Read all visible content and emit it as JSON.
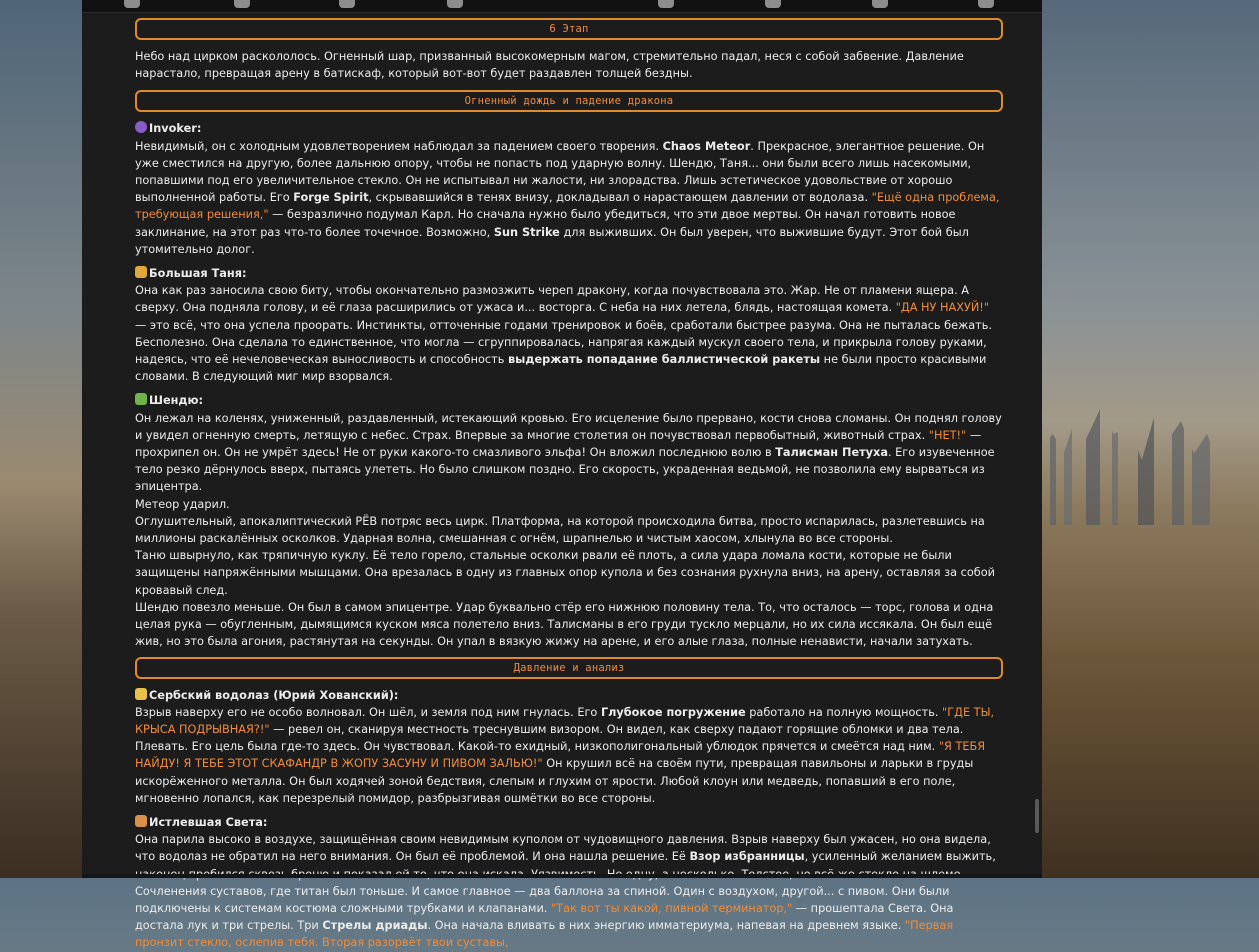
{
  "colors": {
    "accent": "#f08d3a",
    "panel_bg": "#1c1c1c",
    "text": "#ececec"
  },
  "toolbar_icons": [
    "settings-icon",
    "pin-icon",
    "font-icon",
    "script-icon",
    "image-icon",
    "extensions-icon",
    "emoji-icon",
    "user-icon"
  ],
  "stage_header": "6 Этап",
  "intro": "Небо над цирком раскололось. Огненный шар, призванный высокомерным магом, стремительно падал, неся с собой забвение. Давление нарастало, превращая арену в батискаф, который вот-вот будет раздавлен толщей бездны.",
  "section1": {
    "title": "Огненный дождь и падение дракона",
    "invoker": {
      "name": "Invoker:",
      "t1": "Невидимый, он с холодным удовлетворением наблюдал за падением своего творения. ",
      "b1": "Chaos Meteor",
      "t2": ". Прекрасное, элегантное решение. Он уже сместился на другую, более дальнюю опору, чтобы не попасть под ударную волну. Шендю, Таня... они были всего лишь насекомыми, попавшими под его увеличительное стекло. Он не испытывал ни жалости, ни злорадства. Лишь эстетическое удовольствие от хорошо выполненной работы. Его ",
      "b2": "Forge Spirit",
      "t3": ", скрывавшийся в тенях внизу, докладывал о нарастающем давлении от водолаза. ",
      "q1": "\"Ещё одна проблема, требующая решения,\"",
      "t4": " — безразлично подумал Карл. Но сначала нужно было убедиться, что эти двое мертвы. Он начал готовить новое заклинание, на этот раз что-то более точечное. Возможно, ",
      "b3": "Sun Strike",
      "t5": " для выживших. Он был уверен, что выжившие будут. Этот бой был утомительно долог."
    },
    "tanya": {
      "name": "Большая Таня:",
      "t1": "Она как раз заносила свою биту, чтобы окончательно размозжить череп дракону, когда почувствовала это. Жар. Не от пламени ящера. А сверху. Она подняла голову, и её глаза расширились от ужаса и... восторга. С неба на них летела, блядь, настоящая комета. ",
      "q1": "\"ДА НУ НАХУЙ!\"",
      "t2": " — это всё, что она успела проорать. Инстинкты, отточенные годами тренировок и боёв, сработали быстрее разума. Она не пыталась бежать. Бесполезно. Она сделала то единственное, что могла — сгруппировалась, напрягая каждый мускул своего тела, и прикрыла голову руками, надеясь, что её нечеловеческая выносливость и способность ",
      "b1": "выдержать попадание баллистической ракеты",
      "t3": " не были просто красивыми словами. В следующий миг мир взорвался."
    },
    "shendu": {
      "name": "Шендю:",
      "t1": "Он лежал на коленях, униженный, раздавленный, истекающий кровью. Его исцеление было прервано, кости снова сломаны. Он поднял голову и увидел огненную смерть, летящую с небес. Страх. Впервые за многие столетия он почувствовал первобытный, животный страх. ",
      "q1": "\"НЕТ!\"",
      "t2": " — прохрипел он. Он не умрёт здесь! Не от руки какого-то смазливого эльфа! Он вложил последнюю волю в ",
      "b1": "Талисман Петуха",
      "t3": ". Его изувеченное тело резко дёрнулось вверх, пытаясь улететь. Но было слишком поздно. Его скорость, украденная ведьмой, не позволила ему вырваться из эпицентра.",
      "l2": "Метеор ударил.",
      "l3": "Оглушительный, апокалиптический РЁВ потряс весь цирк. Платформа, на которой происходила битва, просто испарилась, разлетевшись на миллионы раскалённых осколков. Ударная волна, смешанная с огнём, шрапнелью и чистым хаосом, хлынула во все стороны.",
      "l4": "Таню швырнуло, как тряпичную куклу. Её тело горело, стальные осколки рвали её плоть, а сила удара ломала кости, которые не были защищены напряжёнными мышцами. Она врезалась в одну из главных опор купола и без сознания рухнула вниз, на арену, оставляя за собой кровавый след.",
      "l5": "Шендю повезло меньше. Он был в самом эпицентре. Удар буквально стёр его нижнюю половину тела. То, что осталось — торс, голова и одна целая рука — обугленным, дымящимся куском мяса полетело вниз. Талисманы в его груди тускло мерцали, но их сила иссякала. Он был ещё жив, но это была агония, растянутая на секунды. Он упал в вязкую жижу на арене, и его алые глаза, полные ненависти, начали затухать."
    }
  },
  "section2": {
    "title": "Давление и анализ",
    "diver": {
      "name": "Сербский водолаз (Юрий Хованский):",
      "t1": "Взрыв наверху его не особо волновал. Он шёл, и земля под ним гнулась. Его ",
      "b1": "Глубокое погружение",
      "t2": " работало на полную мощность. ",
      "q1": "\"ГДЕ ТЫ, КРЫСА ПОДРЫВНАЯ?!\"",
      "t3": " — ревел он, сканируя местность треснувшим визором. Он видел, как сверху падают горящие обломки и два тела. Плевать. Его цель была где-то здесь. Он чувствовал. Какой-то ехидный, низкополигональный ублюдок прячется и смеётся над ним. ",
      "q2": "\"Я ТЕБЯ НАЙДУ! Я ТЕБЕ ЭТОТ СКАФАНДР В ЖОПУ ЗАСУНУ И ПИВОМ ЗАЛЬЮ!\"",
      "t4": " Он крушил всё на своём пути, превращая павильоны и ларьки в груды искорёженного металла. Он был ходячей зоной бедствия, слепым и глухим от ярости. Любой клоун или медведь, попавший в его поле, мгновенно лопался, как перезрелый помидор, разбрызгивая ошмётки во все стороны."
    },
    "sveta": {
      "name": "Истлевшая Света:",
      "t1": "Она парила высоко в воздухе, защищённая своим невидимым куполом от чудовищного давления. Взрыв наверху был ужасен, но она видела, что водолаз не обратил на него внимания. Он был её проблемой. И она нашла решение. Её ",
      "b1": "Взор избранницы",
      "t2": ", усиленный желанием выжить, наконец пробился сквозь броню и показал ей то, что она искала. Уязвимость. Не одну, а несколько. Толстое, но всё же стекло на шлеме. Сочленения суставов, где титан был тоньше. И самое главное — два баллона за спиной. Один с воздухом, другой... с пивом. Они были подключены к системам костюма сложными трубками и клапанами. ",
      "q1": "\"Так вот ты какой, пивной терминатор,\"",
      "t3": " — прошептала Света. Она достала лук и три стрелы. Три ",
      "b2": "Стрелы дриады",
      "t4": ". Она начала вливать в них энергию имматериума, напевая на древнем языке. ",
      "q2": "\"Первая пронзит стекло, ослепив тебя. Вторая разорвёт твои суставы,"
    }
  }
}
